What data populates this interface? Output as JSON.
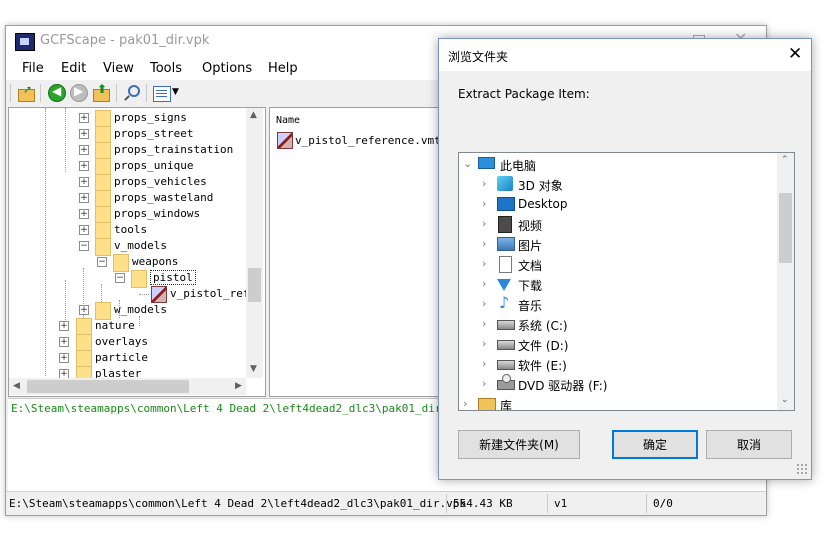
{
  "main_window": {
    "title": "GCFScape - pak01_dir.vpk",
    "menu": [
      "File",
      "Edit",
      "View",
      "Tools",
      "Options",
      "Help"
    ],
    "tree": {
      "items": [
        "props_signs",
        "props_street",
        "props_trainstation",
        "props_unique",
        "props_vehicles",
        "props_wasteland",
        "props_windows",
        "tools",
        "v_models",
        "weapons",
        "pistol",
        "v_pistol_refe",
        "w_models",
        "nature",
        "overlays",
        "particle",
        "plaster"
      ]
    },
    "file_list": {
      "column_name": "Name",
      "files": [
        "v_pistol_reference.vmt"
      ]
    },
    "log_line": "E:\\Steam\\steamapps\\common\\Left 4 Dead 2\\left4dead2_dlc3\\pak01_dir.vpk lo",
    "status": {
      "path": "E:\\Steam\\steamapps\\common\\Left 4 Dead 2\\left4dead2_dlc3\\pak01_dir.vpk",
      "size": "554.43 KB",
      "version": "v1",
      "count": "0/0"
    }
  },
  "dialog": {
    "title": "浏览文件夹",
    "prompt": "Extract Package Item:",
    "folders": [
      {
        "label": "此电脑",
        "icon": "computer-icon"
      },
      {
        "label": "3D 对象",
        "icon": "3d-objects-icon"
      },
      {
        "label": "Desktop",
        "icon": "desktop-icon"
      },
      {
        "label": "视频",
        "icon": "video-icon"
      },
      {
        "label": "图片",
        "icon": "pictures-icon"
      },
      {
        "label": "文档",
        "icon": "documents-icon"
      },
      {
        "label": "下载",
        "icon": "downloads-icon"
      },
      {
        "label": "音乐",
        "icon": "music-icon"
      },
      {
        "label": "系统 (C:)",
        "icon": "drive-icon"
      },
      {
        "label": "文件 (D:)",
        "icon": "drive-icon"
      },
      {
        "label": "软件 (E:)",
        "icon": "drive-icon"
      },
      {
        "label": "DVD 驱动器 (F:)",
        "icon": "dvd-drive-icon"
      },
      {
        "label": "库",
        "icon": "library-icon"
      }
    ],
    "buttons": {
      "new_folder": "新建文件夹(M)",
      "ok": "确定",
      "cancel": "取消"
    }
  }
}
